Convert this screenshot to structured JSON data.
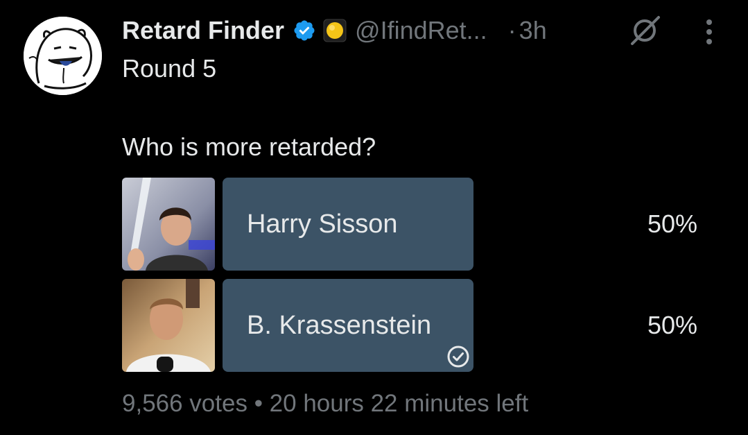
{
  "tweet": {
    "author": {
      "display_name": "Retard Finder",
      "handle": "@IfindRet...",
      "verified_icon": "verified-badge-icon",
      "affiliate_icon": "affiliate-badge-icon",
      "avatar": "cartoon-face-avatar"
    },
    "separator": "·",
    "time": "3h",
    "text": "Round 5",
    "actions": {
      "grok_icon": "grok-icon",
      "more_icon": "more-vertical-icon"
    }
  },
  "poll": {
    "question": "Who is more retarded?",
    "options": [
      {
        "label": "Harry Sisson",
        "percent": "50%",
        "share": 0.5,
        "voted": false,
        "image": "harry-sisson-photo"
      },
      {
        "label": "B. Krassenstein",
        "percent": "50%",
        "share": 0.5,
        "voted": true,
        "image": "b-krassenstein-photo"
      }
    ],
    "footer": "9,566 votes • 20 hours 22 minutes left"
  },
  "colors": {
    "background": "#000000",
    "text_primary": "#e7e9ea",
    "text_secondary": "#71767b",
    "poll_bar": "#3c5366",
    "verified_blue": "#1d9bf0",
    "affiliate_gold": "#f5c518"
  }
}
